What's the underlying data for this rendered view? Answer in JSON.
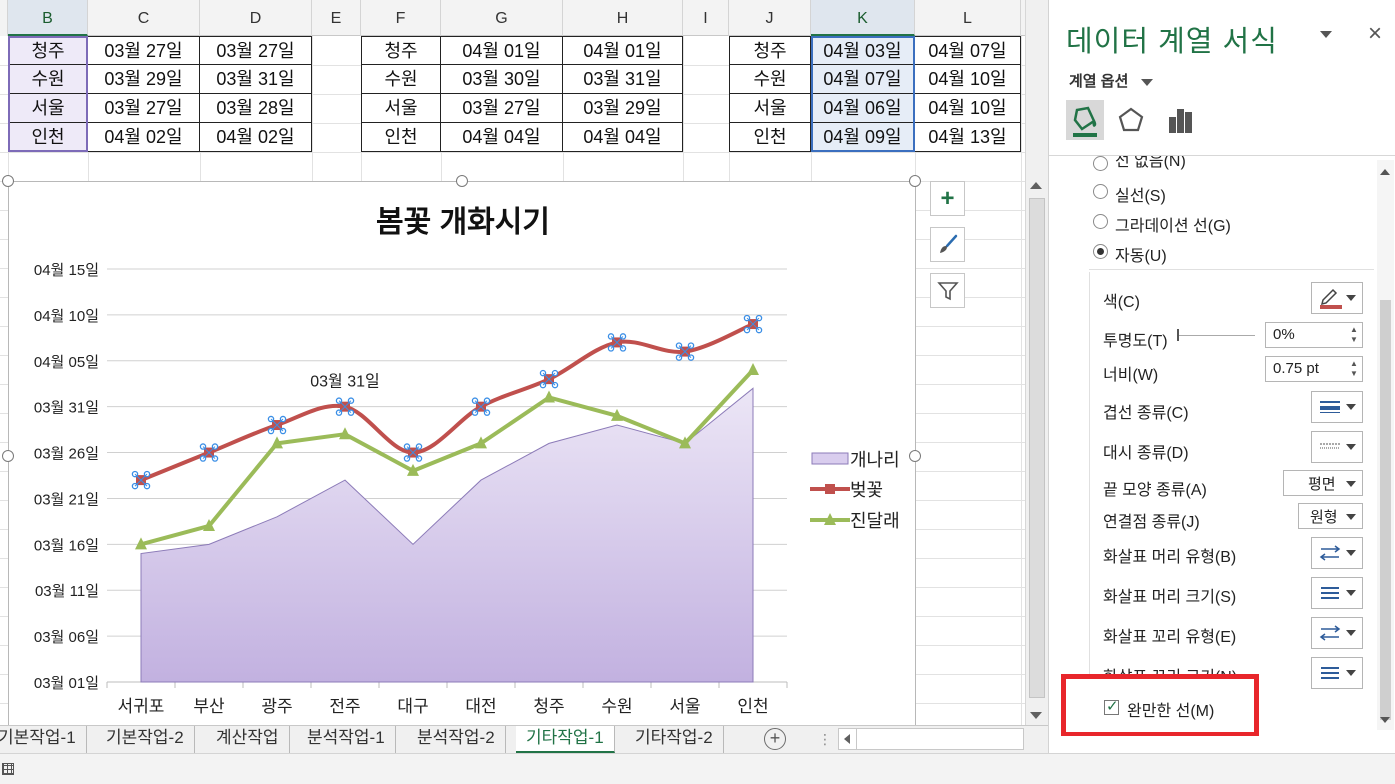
{
  "columns": [
    {
      "id": "B",
      "selected": true
    },
    {
      "id": "C",
      "selected": false
    },
    {
      "id": "D",
      "selected": false
    },
    {
      "id": "E",
      "selected": false
    },
    {
      "id": "F",
      "selected": false
    },
    {
      "id": "G",
      "selected": false
    },
    {
      "id": "H",
      "selected": false
    },
    {
      "id": "I",
      "selected": false
    },
    {
      "id": "J",
      "selected": false
    },
    {
      "id": "K",
      "selected": true
    },
    {
      "id": "L",
      "selected": false
    }
  ],
  "table1": [
    [
      "청주",
      "03월 27일",
      "03월 27일"
    ],
    [
      "수원",
      "03월 29일",
      "03월 31일"
    ],
    [
      "서울",
      "03월 27일",
      "03월 28일"
    ],
    [
      "인천",
      "04월 02일",
      "04월 02일"
    ]
  ],
  "table2": [
    [
      "청주",
      "04월 01일",
      "04월 01일"
    ],
    [
      "수원",
      "03월 30일",
      "03월 31일"
    ],
    [
      "서울",
      "03월 27일",
      "03월 29일"
    ],
    [
      "인천",
      "04월 04일",
      "04월 04일"
    ]
  ],
  "table3": [
    [
      "청주",
      "04월 03일",
      "04월 07일"
    ],
    [
      "수원",
      "04월 07일",
      "04월 10일"
    ],
    [
      "서울",
      "04월 06일",
      "04월 10일"
    ],
    [
      "인천",
      "04월 09일",
      "04월 13일"
    ]
  ],
  "chart_data": {
    "type": "line",
    "title": "봄꽃 개화시기",
    "categories": [
      "서귀포",
      "부산",
      "광주",
      "전주",
      "대구",
      "대전",
      "청주",
      "수원",
      "서울",
      "인천"
    ],
    "series": [
      {
        "name": "개나리",
        "kind": "area",
        "color": "#d9cdee",
        "values": [
          "03월 15일",
          "03월 16일",
          "03월 19일",
          "03월 23일",
          "03월 16일",
          "03월 23일",
          "03월 27일",
          "03월 29일",
          "03월 27일",
          "04월 02일"
        ]
      },
      {
        "name": "벚꽃",
        "kind": "line",
        "color": "#c0504d",
        "values": [
          "03월 23일",
          "03월 26일",
          "03월 29일",
          "03월 31일",
          "03월 26일",
          "03월 31일",
          "04월 03일",
          "04월 07일",
          "04월 06일",
          "04월 09일"
        ]
      },
      {
        "name": "진달래",
        "kind": "line",
        "color": "#9bbb59",
        "values": [
          "03월 16일",
          "03월 18일",
          "03월 27일",
          "03월 28일",
          "03월 24일",
          "03월 27일",
          "04월 01일",
          "03월 30일",
          "03월 27일",
          "04월 04일"
        ]
      }
    ],
    "y_ticks": [
      "03월 01일",
      "03월 06일",
      "03월 11일",
      "03월 16일",
      "03월 21일",
      "03월 26일",
      "03월 31일",
      "04월 05일",
      "04월 10일",
      "04월 15일"
    ],
    "y_tick_days": [
      0,
      5,
      10,
      15,
      20,
      25,
      30,
      35,
      40,
      45
    ],
    "ylim": [
      "03월 01일",
      "04월 15일"
    ],
    "data_label": {
      "series": "벚꽃",
      "category": "전주",
      "text": "03월 31일"
    },
    "legend": "right",
    "grid": true
  },
  "side_buttons": [
    {
      "icon": "plus-icon"
    },
    {
      "icon": "brush-icon"
    },
    {
      "icon": "filter-icon"
    }
  ],
  "sheet_tabs": [
    "기본작업-1",
    "기본작업-2",
    "계산작업",
    "분석작업-1",
    "분석작업-2",
    "기타작업-1",
    "기타작업-2"
  ],
  "active_tab": "기타작업-1",
  "pane": {
    "title": "데이터 계열 서식",
    "options_label": "계열 옵션",
    "tab_icons": [
      "fill-line-icon",
      "effects-icon",
      "series-options-icon"
    ],
    "radio_partial": "선 없음(N)",
    "radios": [
      {
        "label": "실선(S)",
        "checked": false
      },
      {
        "label": "그라데이션 선(G)",
        "checked": false
      },
      {
        "label": "자동(U)",
        "checked": true
      }
    ],
    "color_label": "색(C)",
    "transparency_label": "투명도(T)",
    "transparency_value": "0%",
    "width_label": "너비(W)",
    "width_value": "0.75 pt",
    "compound_label": "겹선 종류(C)",
    "dash_label": "대시 종류(D)",
    "cap_label": "끝 모양 종류(A)",
    "cap_value": "평면",
    "join_label": "연결점 종류(J)",
    "join_value": "원형",
    "begin_arrow_type_label": "화살표 머리 유형(B)",
    "begin_arrow_size_label": "화살표 머리 크기(S)",
    "end_arrow_type_label": "화살표 꼬리 유형(E)",
    "end_arrow_size_label": "화살표 꼬리 크기(N)",
    "smooth_label": "완만한 선(M)",
    "smooth_checked": true,
    "highlight_color": "#e8262b"
  }
}
